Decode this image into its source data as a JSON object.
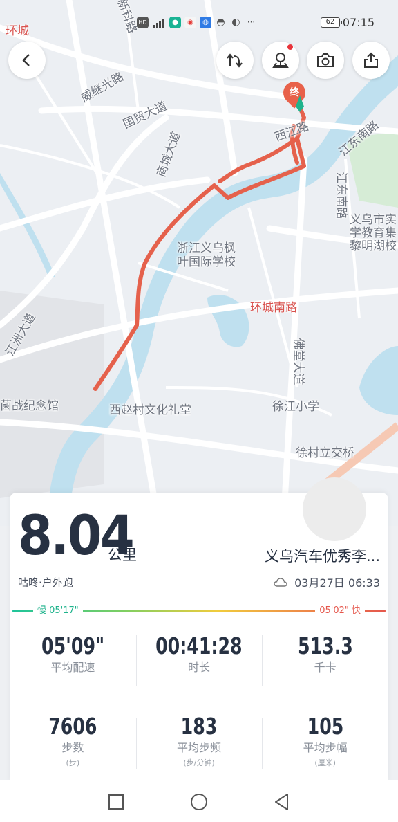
{
  "status_bar": {
    "time": "07:15",
    "battery": "62",
    "icons": [
      "hd-icon",
      "signal-icon",
      "wechat-work-icon",
      "weibo-icon",
      "qq-icon",
      "wechat-icon",
      "app-icon",
      "more-icon"
    ]
  },
  "map": {
    "labels": [
      "环城",
      "新科路",
      "威继光路",
      "国贸大道",
      "商城大道",
      "西江路",
      "江东南路",
      "江东南路",
      "义乌市实",
      "学教育集",
      "黎明湖校",
      "浙江义乌枫",
      "叶国际学校",
      "环城南路",
      "江洲大道",
      "佛堂大道",
      "菌战纪念馆",
      "西赵村文化礼堂",
      "徐江小学",
      "徐村立交桥",
      "江大道",
      "路",
      "道"
    ],
    "end_marker": "终",
    "route_color": "#e5614c"
  },
  "summary": {
    "distance_value": "8.04",
    "distance_unit": "公里",
    "route_name": "义乌汽车优秀李...",
    "activity_type": "咕咚·户外跑",
    "date": "03月27日 06:33",
    "pace_slow_label": "慢 05'17\"",
    "pace_fast_label": "05'02\" 快"
  },
  "metrics_row1": [
    {
      "value": "05'09\"",
      "label": "平均配速"
    },
    {
      "value": "00:41:28",
      "label": "时长"
    },
    {
      "value": "513.3",
      "label": "千卡"
    }
  ],
  "metrics_row2": [
    {
      "value": "7606",
      "label": "步数",
      "sub": "(步)"
    },
    {
      "value": "183",
      "label": "平均步频",
      "sub": "(步/分钟)"
    },
    {
      "value": "105",
      "label": "平均步幅",
      "sub": "(厘米)"
    }
  ]
}
